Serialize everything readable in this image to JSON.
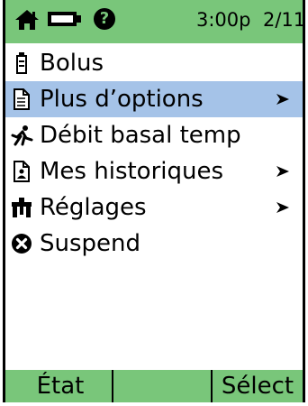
{
  "status_bar": {
    "time": "3:00p",
    "page": "2/11",
    "help": "?"
  },
  "menu": {
    "items": [
      {
        "label": "Bolus",
        "icon": "bolus-icon",
        "has_submenu": false,
        "selected": false
      },
      {
        "label": "Plus d’options",
        "icon": "more-options-icon",
        "has_submenu": true,
        "selected": true
      },
      {
        "label": "Débit basal temp",
        "icon": "temp-basal-icon",
        "has_submenu": false,
        "selected": false
      },
      {
        "label": "Mes historiques",
        "icon": "history-icon",
        "has_submenu": true,
        "selected": false
      },
      {
        "label": "Réglages",
        "icon": "settings-icon",
        "has_submenu": true,
        "selected": false
      },
      {
        "label": "Suspend",
        "icon": "suspend-icon",
        "has_submenu": false,
        "selected": false
      }
    ]
  },
  "softkeys": {
    "left": "État",
    "right": "Sélect"
  },
  "colors": {
    "bar": "#79c67a",
    "selection": "#a5c3e8"
  }
}
